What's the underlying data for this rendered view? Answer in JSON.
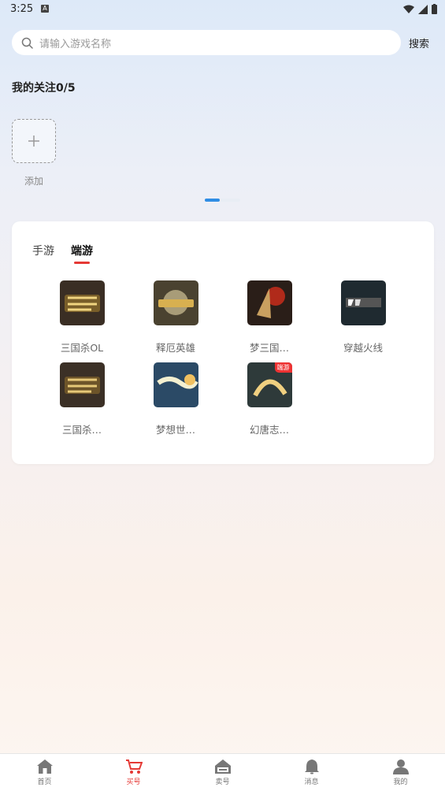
{
  "status": {
    "time": "3:25",
    "app_icon": "A"
  },
  "search": {
    "placeholder": "请输入游戏名称",
    "button": "搜索"
  },
  "follow": {
    "title": "我的关注0/5",
    "add_label": "添加"
  },
  "tabs": [
    {
      "label": "手游",
      "active": false
    },
    {
      "label": "端游",
      "active": true
    }
  ],
  "games": [
    {
      "name": "三国杀OL",
      "icon": "sanguosha-ol-icon",
      "bg": "#3a2e24"
    },
    {
      "name": "释厄英雄",
      "icon": "shie-yingxiong-icon",
      "bg": "#4a4230"
    },
    {
      "name": "梦三国…",
      "icon": "mengsanguo-icon",
      "bg": "#2a1e18"
    },
    {
      "name": "穿越火线",
      "icon": "crossfire-icon",
      "bg": "#1f2a30"
    },
    {
      "name": "三国杀…",
      "icon": "sanguosha-icon",
      "bg": "#3b3026"
    },
    {
      "name": "梦想世…",
      "icon": "mengxiang-shijie-icon",
      "bg": "#2b4a66"
    },
    {
      "name": "幻唐志…",
      "icon": "huantangzhi-icon",
      "bg": "#2e3a3a",
      "badge": "端游"
    }
  ],
  "nav": [
    {
      "label": "首页",
      "icon": "home-icon",
      "active": false
    },
    {
      "label": "买号",
      "icon": "cart-icon",
      "active": true
    },
    {
      "label": "卖号",
      "icon": "sale-tag-icon",
      "active": false
    },
    {
      "label": "消息",
      "icon": "bell-icon",
      "active": false
    },
    {
      "label": "我的",
      "icon": "user-icon",
      "active": false
    }
  ],
  "colors": {
    "accent": "#e53935",
    "pager_active": "#2f8de4"
  }
}
